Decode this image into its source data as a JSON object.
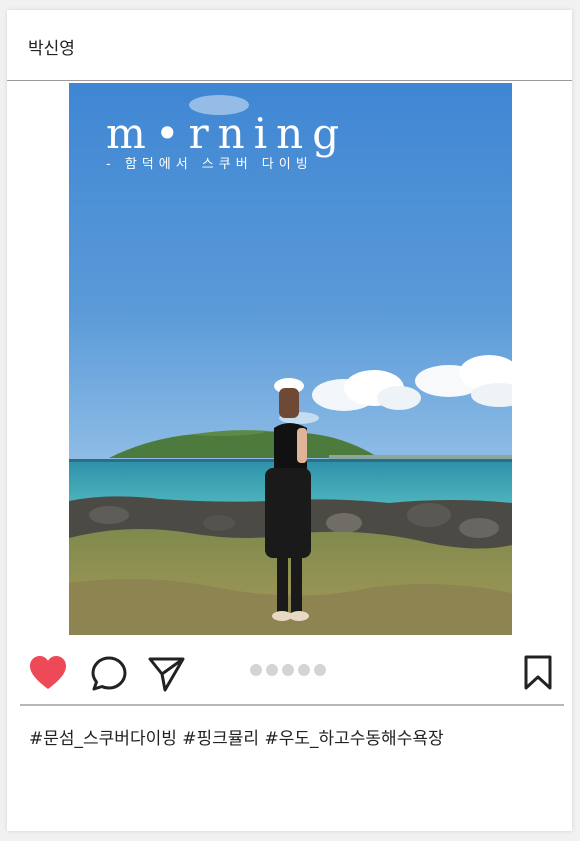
{
  "header": {
    "username": "박신영"
  },
  "photo": {
    "overlay_title": "m•rning",
    "overlay_subtitle": "- 함덕에서 스쿠버 다이빙"
  },
  "actions": {
    "like_icon": "heart-filled-icon",
    "comment_icon": "comment-bubble-icon",
    "share_icon": "paper-plane-icon",
    "save_icon": "bookmark-icon",
    "like_color": "#ed4956",
    "carousel": {
      "count": 5,
      "active_index": 0
    }
  },
  "caption": {
    "hashtags": "#문섬_스쿠버다이빙 #핑크뮬리 #우도_하고수동해수욕장"
  }
}
